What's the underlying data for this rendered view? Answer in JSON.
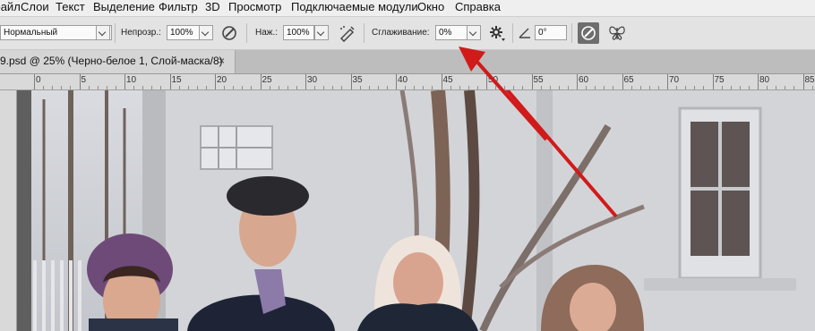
{
  "menubar": {
    "items": [
      "файл",
      "Слои",
      "Текст",
      "Выделение",
      "Фильтр",
      "3D",
      "Просмотр",
      "Подключаемые модули",
      "Окно",
      "Справка"
    ]
  },
  "options": {
    "mode": "Нормальный",
    "opacity_label": "Непрозр.:",
    "opacity_value": "100%",
    "pressure_label": "Наж.:",
    "pressure_value": "100%",
    "smoothing_label": "Сглаживание:",
    "smoothing_value": "0%",
    "angle_value": "0°"
  },
  "document": {
    "tab_title": "9.psd @ 25% (Черно-белое 1, Слой-маска/8)",
    "close_glyph": "×"
  },
  "ruler": {
    "ticks": [
      "0",
      "5",
      "10",
      "15",
      "20",
      "25",
      "30",
      "35",
      "40",
      "45",
      "50",
      "55",
      "60",
      "65",
      "70",
      "75",
      "80",
      "85"
    ]
  },
  "annotation": {
    "arrow_color": "#d11a1a"
  }
}
